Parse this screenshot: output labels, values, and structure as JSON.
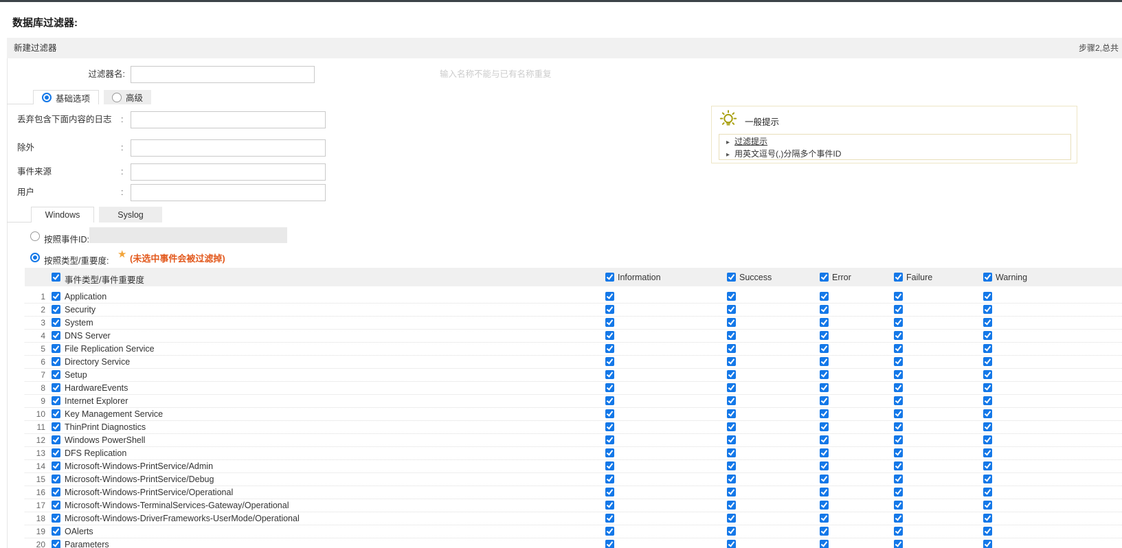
{
  "page": {
    "title": "数据库过滤器:"
  },
  "panel": {
    "header": "新建过滤器",
    "step_info": "步骤2,总共"
  },
  "filter_name": {
    "label": "过滤器名:",
    "value": "",
    "hint": "输入名称不能与已有名称重复"
  },
  "mode_tabs": [
    {
      "label": "基础选项",
      "selected": true
    },
    {
      "label": "高级",
      "selected": false
    }
  ],
  "form": {
    "separator": ":",
    "rows": [
      {
        "label": "丢弃包含下面内容的日志",
        "value": ""
      },
      {
        "label": "除外",
        "value": ""
      },
      {
        "label": "事件来源",
        "value": ""
      },
      {
        "label": "用户",
        "value": ""
      }
    ]
  },
  "tips": {
    "title": "一般提示",
    "bullet_icon": "▸",
    "items": [
      {
        "text": "过滤提示",
        "link": true
      },
      {
        "text": "用英文逗号(,)分隔多个事件ID",
        "link": false
      }
    ]
  },
  "log_tabs": [
    {
      "label": "Windows",
      "active": true
    },
    {
      "label": "Syslog",
      "active": false
    }
  ],
  "event_id": {
    "label": "按照事件ID:",
    "value": "",
    "selected": false
  },
  "type_filter": {
    "label": "按照类型/重要度:",
    "star_icon": "★",
    "warning": "(未选中事件会被过滤掉)",
    "selected": true
  },
  "table": {
    "header": {
      "label": "事件类型/事件重要度",
      "checked": true
    },
    "columns": [
      {
        "label": "Information",
        "checked": true
      },
      {
        "label": "Success",
        "checked": true
      },
      {
        "label": "Error",
        "checked": true
      },
      {
        "label": "Failure",
        "checked": true
      },
      {
        "label": "Warning",
        "checked": true
      }
    ],
    "rows": [
      {
        "num": 1,
        "label": "Application",
        "checked": true,
        "severities": [
          true,
          true,
          true,
          true,
          true
        ]
      },
      {
        "num": 2,
        "label": "Security",
        "checked": true,
        "severities": [
          true,
          true,
          true,
          true,
          true
        ]
      },
      {
        "num": 3,
        "label": "System",
        "checked": true,
        "severities": [
          true,
          true,
          true,
          true,
          true
        ]
      },
      {
        "num": 4,
        "label": "DNS Server",
        "checked": true,
        "severities": [
          true,
          true,
          true,
          true,
          true
        ]
      },
      {
        "num": 5,
        "label": "File Replication Service",
        "checked": true,
        "severities": [
          true,
          true,
          true,
          true,
          true
        ]
      },
      {
        "num": 6,
        "label": "Directory Service",
        "checked": true,
        "severities": [
          true,
          true,
          true,
          true,
          true
        ]
      },
      {
        "num": 7,
        "label": "Setup",
        "checked": true,
        "severities": [
          true,
          true,
          true,
          true,
          true
        ]
      },
      {
        "num": 8,
        "label": "HardwareEvents",
        "checked": true,
        "severities": [
          true,
          true,
          true,
          true,
          true
        ]
      },
      {
        "num": 9,
        "label": "Internet Explorer",
        "checked": true,
        "severities": [
          true,
          true,
          true,
          true,
          true
        ]
      },
      {
        "num": 10,
        "label": "Key Management Service",
        "checked": true,
        "severities": [
          true,
          true,
          true,
          true,
          true
        ]
      },
      {
        "num": 11,
        "label": "ThinPrint Diagnostics",
        "checked": true,
        "severities": [
          true,
          true,
          true,
          true,
          true
        ]
      },
      {
        "num": 12,
        "label": "Windows PowerShell",
        "checked": true,
        "severities": [
          true,
          true,
          true,
          true,
          true
        ]
      },
      {
        "num": 13,
        "label": "DFS Replication",
        "checked": true,
        "severities": [
          true,
          true,
          true,
          true,
          true
        ]
      },
      {
        "num": 14,
        "label": "Microsoft-Windows-PrintService/Admin",
        "checked": true,
        "severities": [
          true,
          true,
          true,
          true,
          true
        ]
      },
      {
        "num": 15,
        "label": "Microsoft-Windows-PrintService/Debug",
        "checked": true,
        "severities": [
          true,
          true,
          true,
          true,
          true
        ]
      },
      {
        "num": 16,
        "label": "Microsoft-Windows-PrintService/Operational",
        "checked": true,
        "severities": [
          true,
          true,
          true,
          true,
          true
        ]
      },
      {
        "num": 17,
        "label": "Microsoft-Windows-TerminalServices-Gateway/Operational",
        "checked": true,
        "severities": [
          true,
          true,
          true,
          true,
          true
        ]
      },
      {
        "num": 18,
        "label": "Microsoft-Windows-DriverFrameworks-UserMode/Operational",
        "checked": true,
        "severities": [
          true,
          true,
          true,
          true,
          true
        ]
      },
      {
        "num": 19,
        "label": "OAlerts",
        "checked": true,
        "severities": [
          true,
          true,
          true,
          true,
          true
        ]
      },
      {
        "num": 20,
        "label": "Parameters",
        "checked": true,
        "severities": [
          true,
          true,
          true,
          true,
          true
        ]
      }
    ]
  },
  "colors": {
    "accent_blue": "#1478e8",
    "warning_orange": "#e2591d",
    "star_orange": "#f2a43a",
    "tip_border": "#e8dfba",
    "header_gray": "#f0f0f0"
  }
}
